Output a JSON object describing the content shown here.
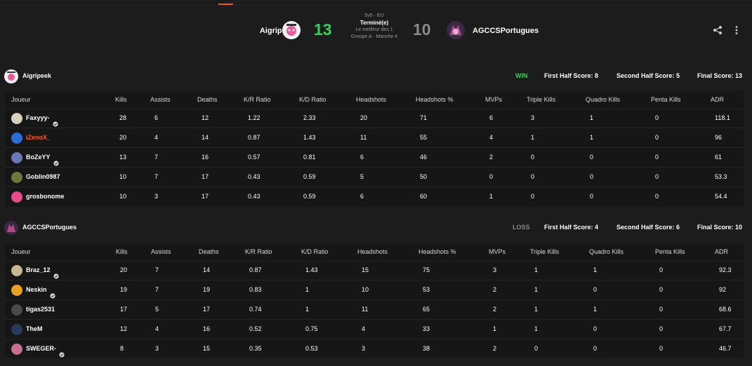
{
  "header": {
    "team_a": {
      "name": "Aigripeek",
      "score": "13"
    },
    "team_b": {
      "name": "AGCCSPortugues",
      "score": "10"
    },
    "format": "5v5 · EU",
    "status": "Terminé(e)",
    "best_of": "Le meilleur des 1",
    "stage": "Groupe A · Manche 4",
    "share_icon": "share-icon",
    "more_icon": "more-vertical-icon"
  },
  "columns": [
    "Joueur",
    "Kills",
    "Assists",
    "Deaths",
    "K/R Ratio",
    "K/D Ratio",
    "Headshots",
    "Headshots %",
    "MVPs",
    "Triple Kills",
    "Quadro Kills",
    "Penta Kills",
    "ADR"
  ],
  "teams": [
    {
      "name": "Aigripeek",
      "result": "WIN",
      "first_half": "First Half Score: 8",
      "second_half": "Second Half Score: 5",
      "final": "Final Score: 13",
      "players": [
        {
          "name": "Faxyyy-",
          "verified": true,
          "highlight": false,
          "stats": [
            "28",
            "6",
            "12",
            "1.22",
            "2.33",
            "20",
            "71",
            "6",
            "3",
            "1",
            "0",
            "118.1"
          ]
        },
        {
          "name": "iZenoX_",
          "verified": false,
          "highlight": true,
          "stats": [
            "20",
            "4",
            "14",
            "0.87",
            "1.43",
            "11",
            "55",
            "4",
            "1",
            "1",
            "0",
            "96"
          ]
        },
        {
          "name": "BoZeYY",
          "verified": true,
          "highlight": false,
          "stats": [
            "13",
            "7",
            "16",
            "0.57",
            "0.81",
            "6",
            "46",
            "2",
            "0",
            "0",
            "0",
            "61"
          ]
        },
        {
          "name": "Goblin0987",
          "verified": false,
          "highlight": false,
          "stats": [
            "10",
            "7",
            "17",
            "0.43",
            "0.59",
            "5",
            "50",
            "0",
            "0",
            "0",
            "0",
            "53.3"
          ]
        },
        {
          "name": "grosbonome",
          "verified": false,
          "highlight": false,
          "stats": [
            "10",
            "3",
            "17",
            "0.43",
            "0.59",
            "6",
            "60",
            "1",
            "0",
            "0",
            "0",
            "54.4"
          ]
        }
      ]
    },
    {
      "name": "AGCCSPortugues",
      "result": "LOSS",
      "first_half": "First Half Score: 4",
      "second_half": "Second Half Score: 6",
      "final": "Final Score: 10",
      "players": [
        {
          "name": "Braz_12",
          "verified": true,
          "highlight": false,
          "stats": [
            "20",
            "7",
            "14",
            "0.87",
            "1.43",
            "15",
            "75",
            "3",
            "1",
            "1",
            "0",
            "92.3"
          ]
        },
        {
          "name": "Neskin",
          "verified": true,
          "highlight": false,
          "stats": [
            "19",
            "7",
            "19",
            "0.83",
            "1",
            "10",
            "53",
            "2",
            "1",
            "0",
            "0",
            "92"
          ]
        },
        {
          "name": "tigas2531",
          "verified": false,
          "highlight": false,
          "stats": [
            "17",
            "5",
            "17",
            "0.74",
            "1",
            "11",
            "65",
            "2",
            "1",
            "1",
            "0",
            "68.6"
          ]
        },
        {
          "name": "TheM",
          "verified": false,
          "highlight": false,
          "stats": [
            "12",
            "4",
            "16",
            "0.52",
            "0.75",
            "4",
            "33",
            "1",
            "1",
            "0",
            "0",
            "67.7"
          ]
        },
        {
          "name": "SWEGER-",
          "verified": true,
          "highlight": false,
          "stats": [
            "8",
            "3",
            "15",
            "0.35",
            "0.53",
            "3",
            "38",
            "2",
            "0",
            "0",
            "0",
            "46.7"
          ]
        }
      ]
    }
  ],
  "colors": {
    "win": "#32d35a",
    "loss": "#8a8a8a",
    "accent": "#ff5500",
    "highlight_name": "#ff5a1f"
  }
}
